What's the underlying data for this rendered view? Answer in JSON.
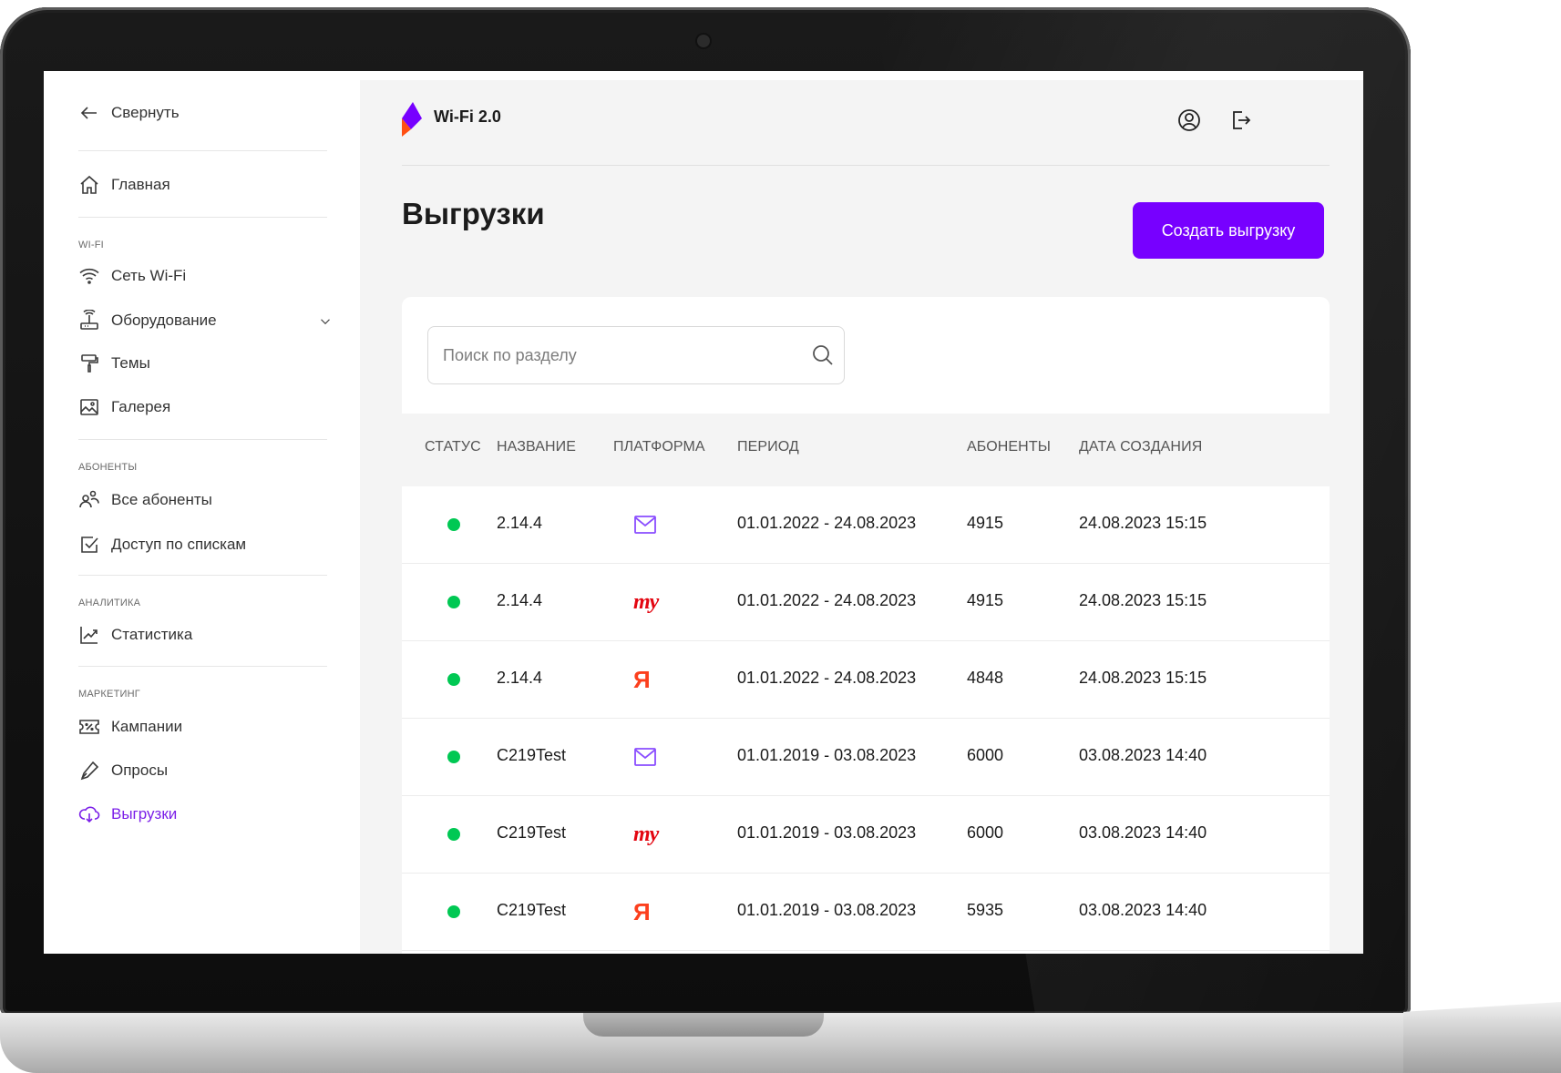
{
  "sidebar": {
    "collapse_label": "Свернуть",
    "home_label": "Главная",
    "sections": {
      "wifi": "WI-FI",
      "subscribers": "АБОНЕНТЫ",
      "analytics": "АНАЛИТИКА",
      "marketing": "МАРКЕТИНГ"
    },
    "items": {
      "wifi_network": "Сеть Wi-Fi",
      "equipment": "Оборудование",
      "themes": "Темы",
      "gallery": "Галерея",
      "all_subscribers": "Все абоненты",
      "list_access": "Доступ по спискам",
      "statistics": "Статистика",
      "campaigns": "Кампании",
      "surveys": "Опросы",
      "exports": "Выгрузки"
    }
  },
  "header": {
    "brand": "Wi-Fi 2.0"
  },
  "page": {
    "title": "Выгрузки",
    "create_button": "Создать выгрузку",
    "search_placeholder": "Поиск по разделу"
  },
  "table": {
    "columns": [
      "СТАТУС",
      "НАЗВАНИЕ",
      "ПЛАТФОРМА",
      "ПЕРИОД",
      "АБОНЕНТЫ",
      "ДАТА СОЗДАНИЯ"
    ],
    "rows": [
      {
        "name": "2.14.4",
        "platform": "mail",
        "period": "01.01.2022 - 24.08.2023",
        "subscribers": "4915",
        "created": "24.08.2023 15:15"
      },
      {
        "name": "2.14.4",
        "platform": "mts",
        "platform_text": "my",
        "period": "01.01.2022 - 24.08.2023",
        "subscribers": "4915",
        "created": "24.08.2023 15:15"
      },
      {
        "name": "2.14.4",
        "platform": "yandex",
        "platform_text": "Я",
        "period": "01.01.2022 - 24.08.2023",
        "subscribers": "4848",
        "created": "24.08.2023 15:15"
      },
      {
        "name": "C219Test",
        "platform": "mail",
        "period": "01.01.2019 - 03.08.2023",
        "subscribers": "6000",
        "created": "03.08.2023 14:40"
      },
      {
        "name": "C219Test",
        "platform": "mts",
        "platform_text": "my",
        "period": "01.01.2019 - 03.08.2023",
        "subscribers": "6000",
        "created": "03.08.2023 14:40"
      },
      {
        "name": "C219Test",
        "platform": "yandex",
        "platform_text": "Я",
        "period": "01.01.2019 - 03.08.2023",
        "subscribers": "5935",
        "created": "03.08.2023 14:40"
      }
    ]
  },
  "colors": {
    "accent": "#7700ff",
    "active_nav": "#7b1fe8",
    "status_active": "#00c853",
    "mts_red": "#e30611",
    "yandex_red": "#fc3f1d"
  }
}
